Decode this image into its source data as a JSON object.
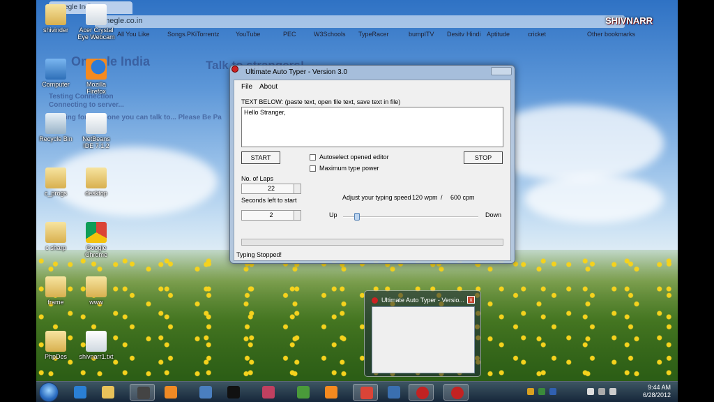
{
  "browser": {
    "tab_title": "Omegle India",
    "address": "omegle.co.in",
    "bookmarks": [
      "All You Like",
      "Songs.PK",
      "iTorrentz",
      "YouTube",
      "PEC",
      "W3Schools",
      "TypeRacer",
      "bumpITV",
      "Desitv",
      "Hindi",
      "Aptitude",
      "cricket",
      "Other bookmarks"
    ],
    "ghost_logo": "Omegle India",
    "ghost_heading": "Talk to strangers!",
    "ghost_lines": [
      "Testing Connection",
      "Connecting to server...",
      "Looking for someone you can talk to... Please Be Pa"
    ]
  },
  "watermark": "SHIVNARR",
  "desktop_icons": [
    {
      "label": "shivinder",
      "kind": "folder"
    },
    {
      "label": "Acer Crystal Eye Webcam",
      "kind": "file"
    },
    {
      "label": "Computer",
      "kind": "computer"
    },
    {
      "label": "Mozilla Firefox",
      "kind": "firefox"
    },
    {
      "label": "Recycle Bin",
      "kind": "bin"
    },
    {
      "label": "NetBeans IDE 7.1.2",
      "kind": "file"
    },
    {
      "label": "c_progs",
      "kind": "folder"
    },
    {
      "label": "desktop",
      "kind": "folder"
    },
    {
      "label": "c sharp",
      "kind": "folder"
    },
    {
      "label": "Google Chrome",
      "kind": "chrome"
    },
    {
      "label": "frame",
      "kind": "folder"
    },
    {
      "label": "www",
      "kind": "folder"
    },
    {
      "label": "PhpDes",
      "kind": "folder"
    },
    {
      "label": "shivnarr1.txt",
      "kind": "file"
    }
  ],
  "app": {
    "title": "Ultimate Auto Typer - Version 3.0",
    "menu": [
      "File",
      "About"
    ],
    "text_label": "TEXT BELOW: (paste text, open file text, save text in file)",
    "text_value": "Hello Stranger,",
    "start_label": "START",
    "stop_label": "STOP",
    "autoselect_label": "Autoselect opened editor",
    "autoselect_checked": false,
    "max_power_label": "Maximum type power",
    "max_power_checked": false,
    "laps_label": "No. of Laps",
    "laps_value": "22",
    "seconds_label": "Seconds left to start",
    "seconds_value": "2",
    "speed_label": "Adjust your typing speed",
    "wpm": "120 wpm",
    "sep": "/",
    "cpm": "600 cpm",
    "slider_up": "Up",
    "slider_down": "Down",
    "status": "Typing Stopped!"
  },
  "preview": {
    "title": "Ultimate Auto Typer - Versio...",
    "close": "x"
  },
  "taskbar": {
    "time": "9:44 AM",
    "date": "6/28/2012",
    "apps": [
      {
        "name": "ie-icon",
        "color": "#2a7fd4"
      },
      {
        "name": "explorer-icon",
        "color": "#e8c25a"
      },
      {
        "name": "media-player-icon",
        "color": "#444"
      },
      {
        "name": "wmp-icon",
        "color": "#f08a24"
      },
      {
        "name": "monitor-icon",
        "color": "#4a7fc0"
      },
      {
        "name": "cmd-icon",
        "color": "#111"
      },
      {
        "name": "paint-icon",
        "color": "#c04060"
      },
      {
        "name": "notepadpp-icon",
        "color": "#4a9a3a"
      },
      {
        "name": "firefox-icon",
        "color": "#f58a1f"
      },
      {
        "name": "chrome-icon",
        "color": "#db4437"
      },
      {
        "name": "python-icon",
        "color": "#3a6fb0"
      },
      {
        "name": "autotyper-icon",
        "color": "#c22222"
      },
      {
        "name": "autotyper-icon-2",
        "color": "#c22222"
      }
    ]
  }
}
